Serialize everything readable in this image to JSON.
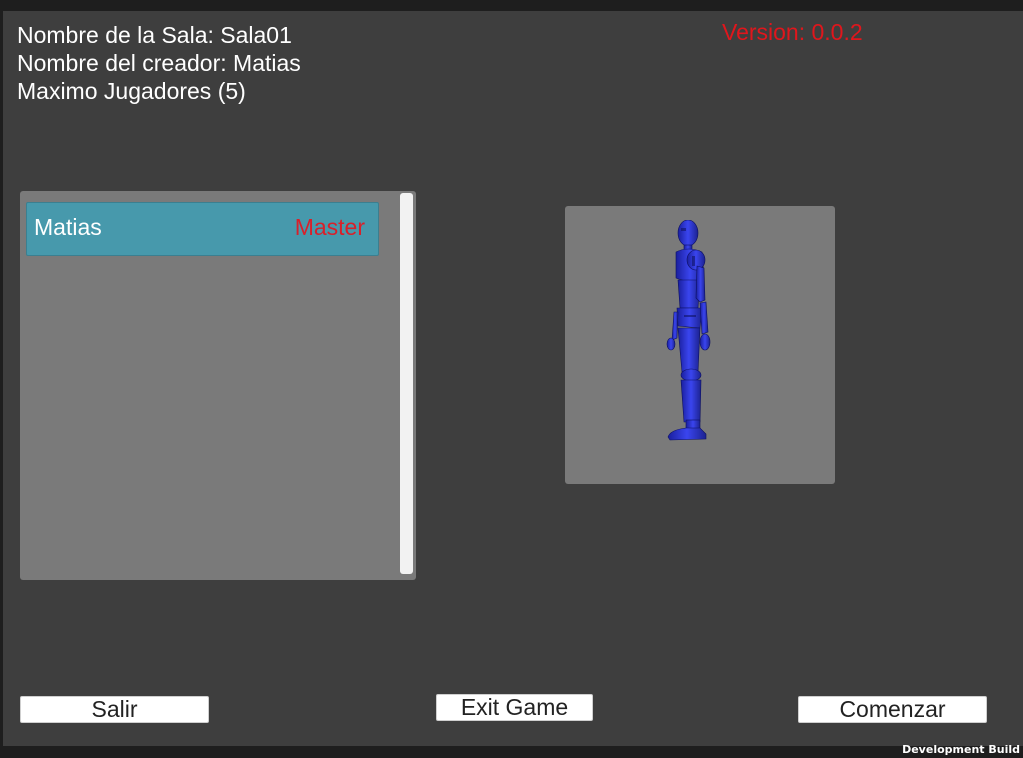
{
  "room_info": {
    "room_name": "Nombre de la Sala: Sala01",
    "creator": "Nombre del creador: Matias",
    "max_players": "Maximo Jugadores (5)"
  },
  "version": "Version: 0.0.2",
  "players": [
    {
      "name": "Matias",
      "role": "Master"
    }
  ],
  "character_preview": {
    "model_icon": "blue-humanoid-robot"
  },
  "buttons": {
    "exit_room": "Salir",
    "exit_game": "Exit Game",
    "start": "Comenzar"
  },
  "watermark": "Development Build",
  "colors": {
    "version_text": "#e0161c",
    "player_row": "#4799ac",
    "master_label": "#d9202a",
    "panel": "#7a7a7a",
    "background": "#3e3e3e"
  }
}
